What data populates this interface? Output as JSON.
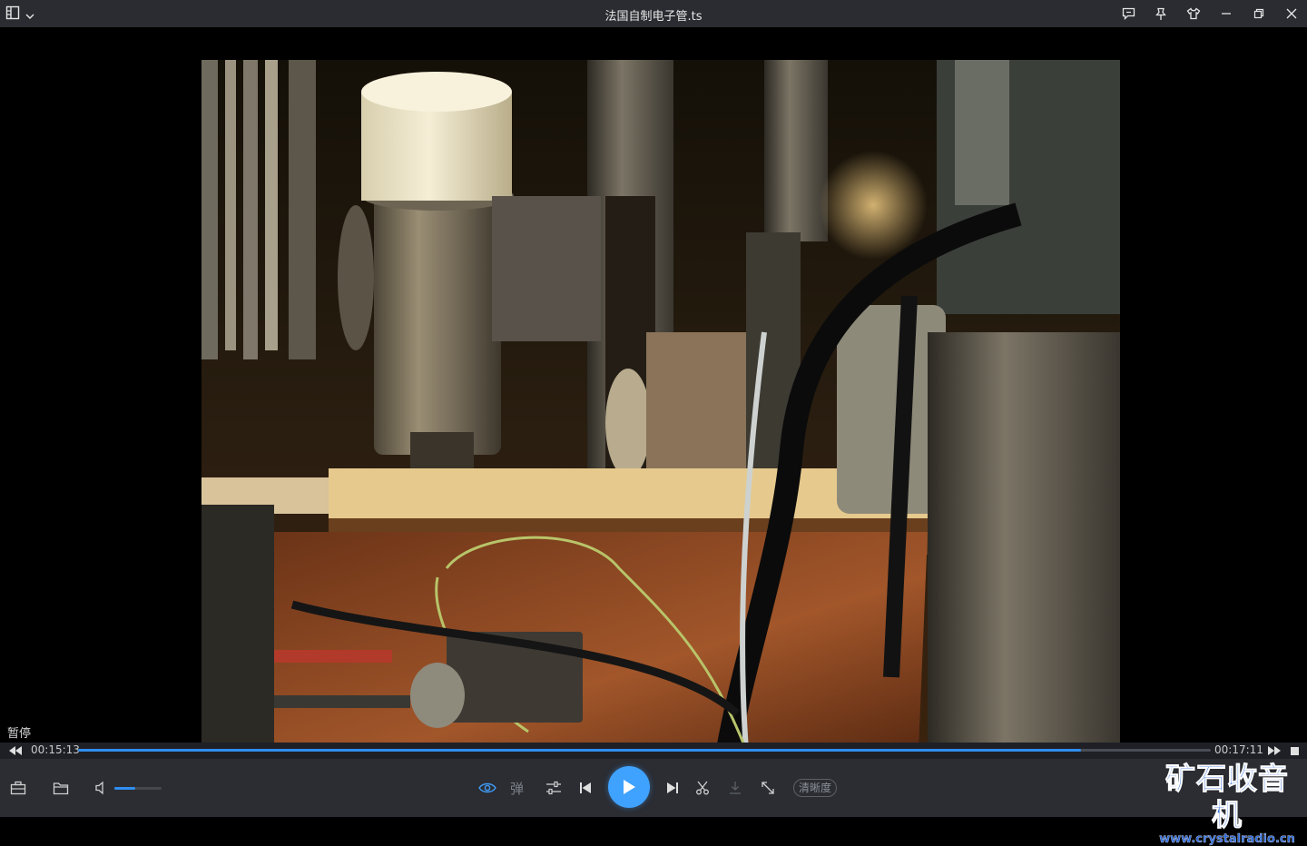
{
  "window": {
    "title": "法国自制电子管.ts",
    "menu_icon": "playlist-menu-icon",
    "controls": [
      "feedback-icon",
      "pin-icon",
      "skin-icon",
      "minimize-icon",
      "restore-icon",
      "close-icon"
    ]
  },
  "player": {
    "status_text": "暂停",
    "current_time": "00:15:13",
    "total_time": "00:17:11",
    "progress_fraction": 0.8856,
    "volume_fraction": 0.45,
    "danmaku_label": "弹",
    "quality_label": "清晰度"
  },
  "watermark": {
    "name": "矿石收音机",
    "url": "www.crystalradio.cn"
  },
  "colors": {
    "accent": "#2f8ff0",
    "play_button": "#3fa2ff",
    "titlebar": "#2a2c31",
    "controlbar": "#2b2d33"
  }
}
